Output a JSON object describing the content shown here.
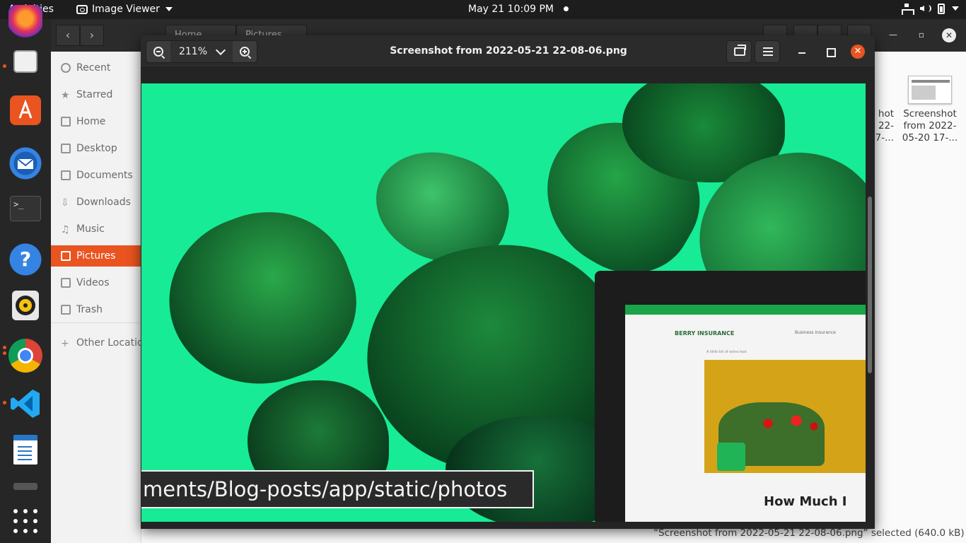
{
  "topbar": {
    "activities": "Activities",
    "app_name": "Image Viewer",
    "clock": "May 21  10:09 PM"
  },
  "dock": {
    "apps": [
      "firefox-icon",
      "files-icon",
      "app-center-icon",
      "thunderbird-icon",
      "terminal-icon",
      "help-icon",
      "rhythmbox-icon",
      "chrome-icon",
      "vscode-icon",
      "libreoffice-writer-icon",
      "trash-icon",
      "show-apps-icon"
    ]
  },
  "nautilus": {
    "path": [
      "Home",
      "Pictures"
    ],
    "sidebar": [
      {
        "label": "Recent",
        "icon": "clock-icon"
      },
      {
        "label": "Starred",
        "icon": "star-icon"
      },
      {
        "label": "Home",
        "icon": "home-icon"
      },
      {
        "label": "Desktop",
        "icon": "desktop-icon"
      },
      {
        "label": "Documents",
        "icon": "documents-icon"
      },
      {
        "label": "Downloads",
        "icon": "downloads-icon"
      },
      {
        "label": "Music",
        "icon": "music-icon"
      },
      {
        "label": "Pictures",
        "icon": "pictures-icon"
      },
      {
        "label": "Videos",
        "icon": "videos-icon"
      },
      {
        "label": "Trash",
        "icon": "trash-icon"
      },
      {
        "label": "Other Locations",
        "icon": "plus-icon"
      }
    ],
    "files": [
      {
        "line1": "hot",
        "line2": "22-",
        "line3": "7-..."
      },
      {
        "line1": "Screenshot",
        "line2": "from 2022-",
        "line3": "05-20 17-..."
      }
    ],
    "status": "“Screenshot from 2022-05-21 22-08-06.png” selected  (640.0 kB)"
  },
  "viewer": {
    "zoom": "211%",
    "title": "Screenshot from 2022-05-21 22-08-06.png",
    "image": {
      "tooltip_text": "ments/Blog-posts/app/static/photos",
      "site_logo": "BERRY INSURANCE",
      "site_nav": "Business Insurance",
      "site_sub": "A little bit of extra text",
      "site_heading": "How Much I"
    }
  },
  "colors": {
    "accent": "#e95420",
    "photo_bg": "#17eb96",
    "leaf_dark": "#0d5a2a",
    "leaf_mid": "#1d8a3c"
  }
}
